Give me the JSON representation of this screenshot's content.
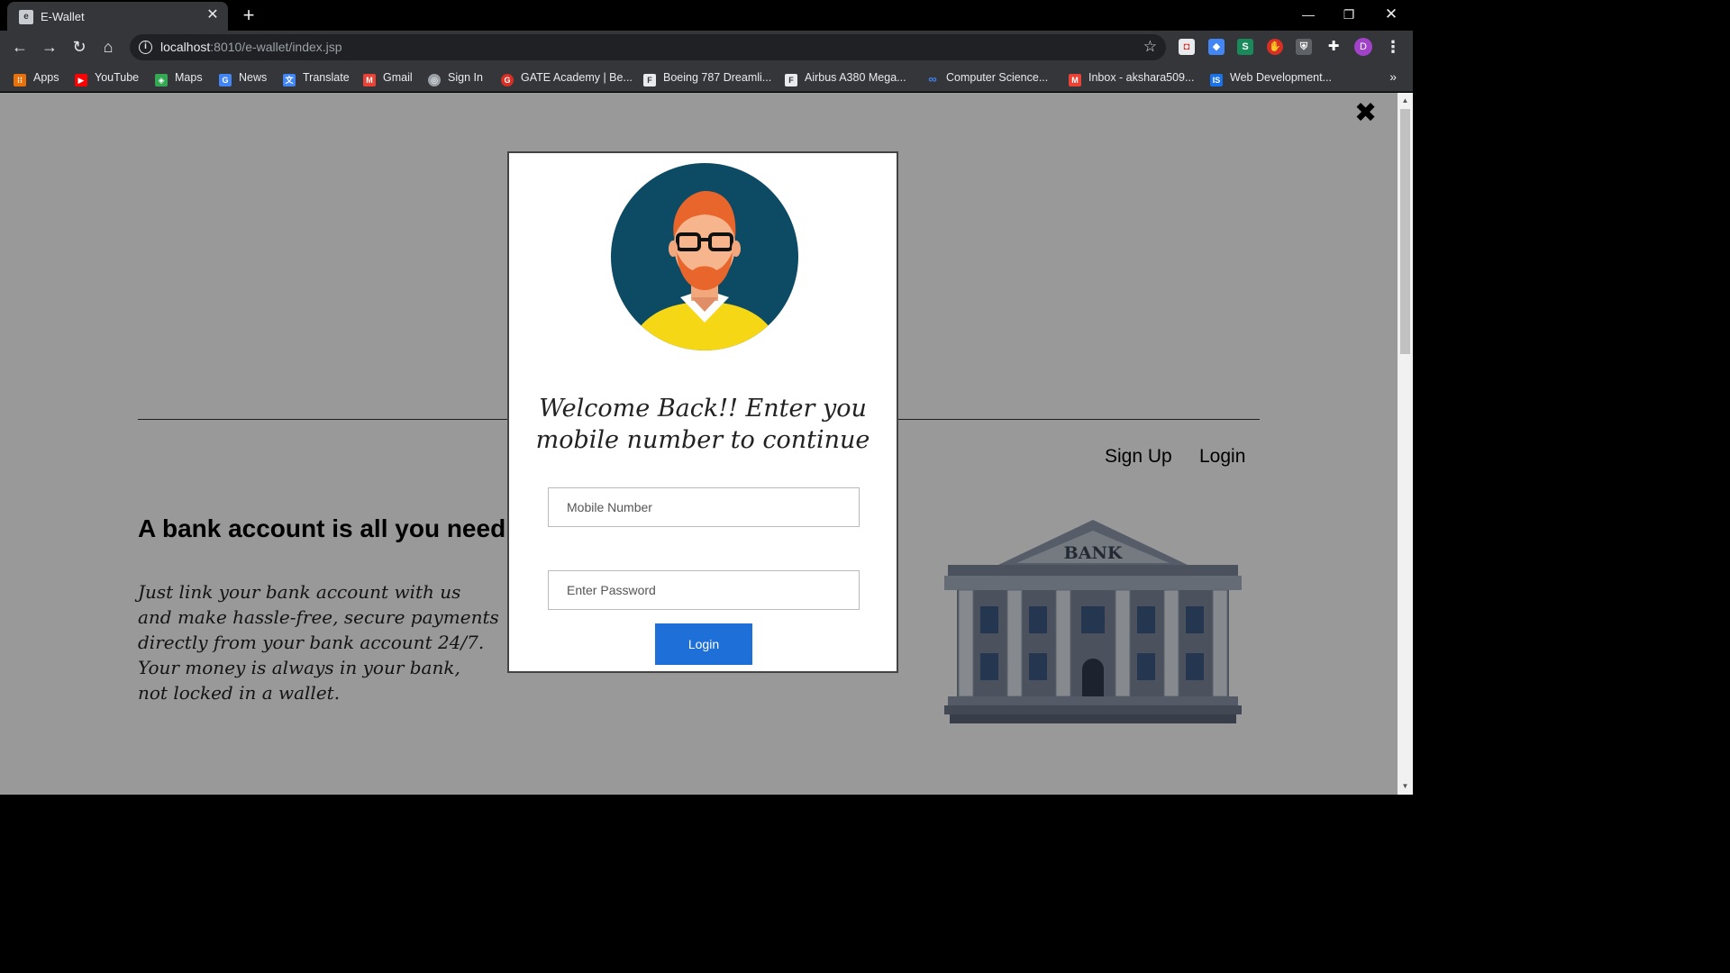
{
  "browser": {
    "tab_title": "E-Wallet",
    "tab_favicon_letter": "e",
    "url_host": "localhost",
    "url_path": ":8010/e-wallet/index.jsp",
    "profile_initial": "D",
    "bookmarks": [
      {
        "label": "Apps",
        "icon": "apps-grid-icon",
        "color": "#e8710a"
      },
      {
        "label": "YouTube",
        "icon": "youtube-icon",
        "color": "#ff0000"
      },
      {
        "label": "Maps",
        "icon": "maps-icon",
        "color": "#34a853"
      },
      {
        "label": "News",
        "icon": "news-icon",
        "color": "#4285f4"
      },
      {
        "label": "Translate",
        "icon": "translate-icon",
        "color": "#4285f4"
      },
      {
        "label": "Gmail",
        "icon": "gmail-icon",
        "color": "#ea4335"
      },
      {
        "label": "Sign In",
        "icon": "globe-icon",
        "color": "#9aa0a6"
      },
      {
        "label": "GATE Academy | Be...",
        "icon": "gate-academy-icon",
        "color": "#d93025"
      },
      {
        "label": "Boeing 787 Dreamli...",
        "icon": "flaticon-icon",
        "color": "#ffffff"
      },
      {
        "label": "Airbus A380 Mega...",
        "icon": "flaticon-icon",
        "color": "#ffffff"
      },
      {
        "label": "Computer Science...",
        "icon": "infinity-icon",
        "color": "#4285f4"
      },
      {
        "label": "Inbox - akshara509...",
        "icon": "gmail-icon",
        "color": "#ea4335"
      },
      {
        "label": "Web Development...",
        "icon": "is-icon",
        "color": "#1a73e8"
      }
    ],
    "more_bookmarks": "»"
  },
  "page": {
    "nav": {
      "signup": "Sign Up",
      "login": "Login"
    },
    "headline": "A bank account is all you need",
    "body_lines": [
      "Just link your bank account with us",
      "and make hassle-free, secure payments",
      "directly from your bank account 24/7.",
      "Your money is always in your bank,",
      "not locked in a wallet."
    ],
    "bank_sign": "BANK"
  },
  "modal": {
    "title": "Welcome Back!! Enter you mobile number to continue",
    "mobile_placeholder": "Mobile Number",
    "password_placeholder": "Enter Password",
    "login_button": "Login",
    "close_symbol": "✖"
  },
  "colors": {
    "primary_button": "#1f6fd8",
    "avatar_bg": "#0d4a63",
    "avatar_shirt": "#f5d716",
    "avatar_hair": "#e8652b"
  }
}
